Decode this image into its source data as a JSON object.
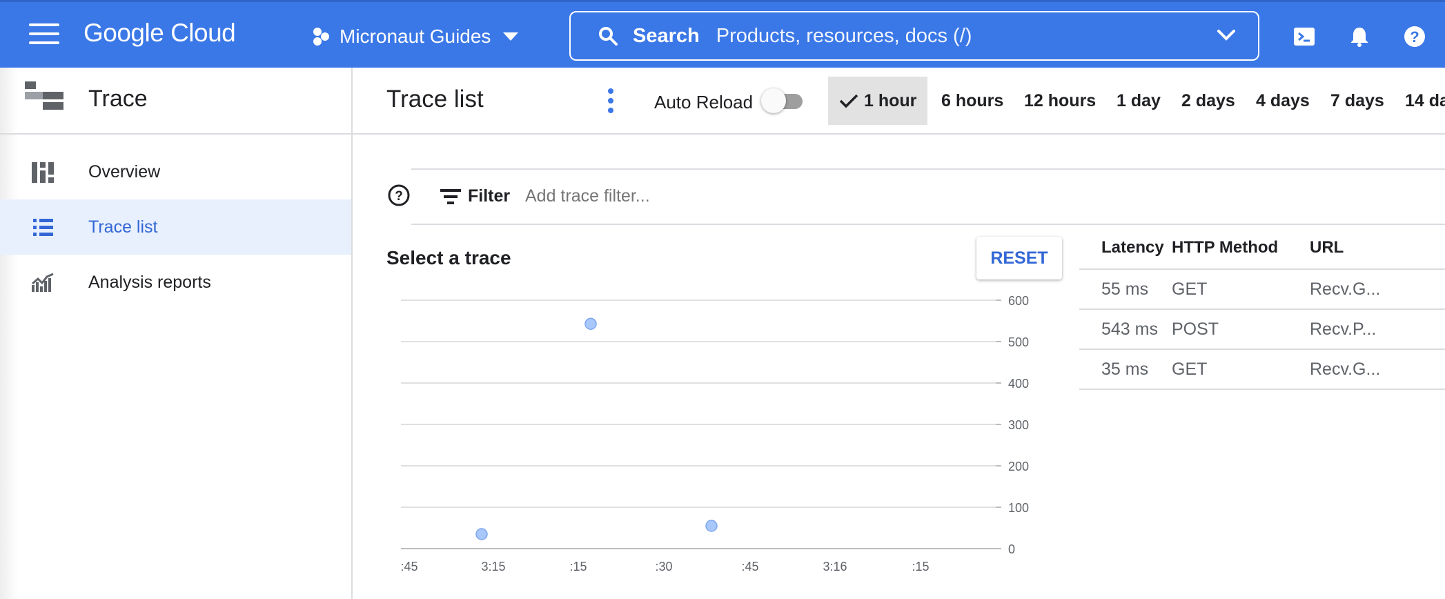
{
  "topbar": {
    "logo": "Google Cloud",
    "project": "Micronaut Guides",
    "search_label": "Search",
    "search_placeholder": "Products, resources, docs (/)",
    "icons": [
      "menu-icon",
      "project-icon",
      "search-icon",
      "chevron-down-icon",
      "cloud-shell-icon",
      "notifications-icon",
      "help-icon"
    ]
  },
  "sidebar": {
    "title": "Trace",
    "items": [
      {
        "label": "Overview",
        "icon": "dashboard-icon",
        "active": false
      },
      {
        "label": "Trace list",
        "icon": "list-icon",
        "active": true
      },
      {
        "label": "Analysis reports",
        "icon": "analytics-icon",
        "active": false
      }
    ]
  },
  "main": {
    "title": "Trace list",
    "auto_reload_label": "Auto Reload",
    "auto_reload_on": false,
    "time_ranges": [
      "1 hour",
      "6 hours",
      "12 hours",
      "1 day",
      "2 days",
      "4 days",
      "7 days",
      "14 da"
    ],
    "selected_range": "1 hour",
    "filter_label": "Filter",
    "filter_placeholder": "Add trace filter...",
    "select_title": "Select a trace",
    "reset_label": "RESET"
  },
  "table": {
    "headers": [
      "Latency",
      "HTTP Method",
      "URL"
    ],
    "rows": [
      [
        "55 ms",
        "GET",
        "Recv.G..."
      ],
      [
        "543 ms",
        "POST",
        "Recv.P..."
      ],
      [
        "35 ms",
        "GET",
        "Recv.G..."
      ]
    ]
  },
  "chart_data": {
    "type": "scatter",
    "title": "",
    "xlabel": "",
    "ylabel": "",
    "ylim": [
      0,
      600
    ],
    "yticks": [
      0,
      100,
      200,
      300,
      400,
      500,
      600
    ],
    "xtick_labels": [
      ":45",
      "3:15",
      ":15",
      ":30",
      ":45",
      "3:16",
      ":15"
    ],
    "y_axis_side": "right",
    "grid": true,
    "marker_color": "#a8c7fa",
    "marker_stroke": "#7ea7ef",
    "points": [
      {
        "x": "3:15",
        "latency_ms": 35
      },
      {
        "x": ":15",
        "latency_ms": 543
      },
      {
        "x": ":45",
        "latency_ms": 55
      }
    ]
  },
  "colors": {
    "header_blue": "#3b78e7",
    "accent_blue": "#3367d6",
    "active_bg": "#e8f0fe",
    "selected_range_bg": "#e2e2e2"
  }
}
